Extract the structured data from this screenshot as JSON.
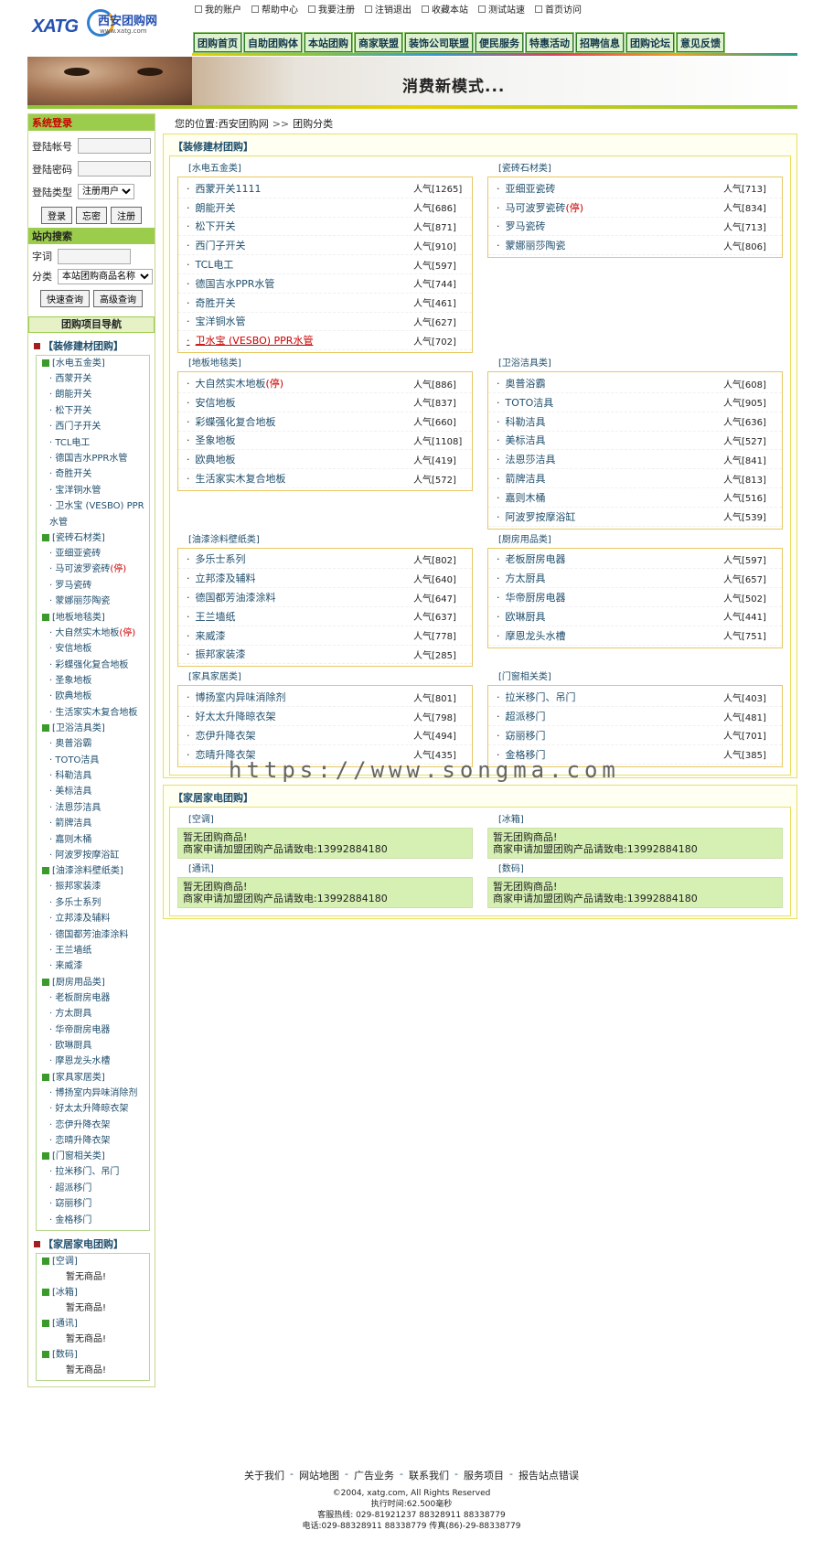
{
  "logo": {
    "brand": "XATG",
    "name": "西安团购网",
    "url": "www.xatg.com"
  },
  "toplinks": [
    "我的账户",
    "帮助中心",
    "我要注册",
    "注销退出",
    "收藏本站",
    "测试站速",
    "首页访问"
  ],
  "nav": [
    "团购首页",
    "自助团购体",
    "本站团购",
    "商家联盟",
    "装饰公司联盟",
    "便民服务",
    "特惠活动",
    "招聘信息",
    "团购论坛",
    "意见反馈"
  ],
  "banner": {
    "slogan": "消费新模式..."
  },
  "login": {
    "title": "系统登录",
    "account_label": "登陆帐号",
    "password_label": "登陆密码",
    "type_label": "登陆类型",
    "type_value": "注册用户",
    "btn_login": "登录",
    "btn_forgot": "忘密",
    "btn_register": "注册"
  },
  "search": {
    "title": "站内搜索",
    "keyword_label": "字词",
    "category_label": "分类",
    "category_value": "本站团购商品名称",
    "btn_quick": "快速查询",
    "btn_advanced": "高级查询"
  },
  "tree_nav": {
    "title": "团购项目导航",
    "cat1": {
      "label": "【装修建材团购】",
      "subs": [
        {
          "label": "[水电五金类]",
          "items": [
            "西蒙开关",
            "朗能开关",
            "松下开关",
            "西门子开关",
            "TCL电工",
            "德国吉水PPR水管",
            "奇胜开关",
            "宝洋铜水管",
            "卫水宝 (VESBO) PPR水管"
          ]
        },
        {
          "label": "[瓷砖石材类]",
          "items": [
            "亚细亚瓷砖",
            "马可波罗瓷砖",
            "罗马瓷砖",
            "蒙娜丽莎陶瓷"
          ]
        },
        {
          "label": "[地板地毯类]",
          "items": [
            "大自然实木地板",
            "安信地板",
            "彩蝶强化复合地板",
            "圣象地板",
            "欧典地板",
            "生活家实木复合地板"
          ]
        },
        {
          "label": "[卫浴洁具类]",
          "items": [
            "奥普浴霸",
            "TOTO洁具",
            "科勒洁具",
            "美标洁具",
            "法恩莎洁具",
            "箭牌洁具",
            "嘉则木桶",
            "阿波罗按摩浴缸"
          ]
        },
        {
          "label": "[油漆涂料壁纸类]",
          "items": [
            "振邦家装漆",
            "多乐士系列",
            "立邦漆及辅料",
            "德国都芳油漆涂料",
            "王兰墙纸",
            "来威漆"
          ]
        },
        {
          "label": "[厨房用品类]",
          "items": [
            "老板厨房电器",
            "方太厨具",
            "华帝厨房电器",
            "欧琳厨具",
            "摩恩龙头水槽"
          ]
        },
        {
          "label": "[家具家居类]",
          "items": [
            "博扬室内异味消除剂",
            "好太太升降晾衣架",
            "恋伊升降衣架",
            "恋晴升降衣架"
          ]
        },
        {
          "label": "[门窗相关类]",
          "items": [
            "拉米移门、吊门",
            "超派移门",
            "窈丽移门",
            "金格移门"
          ]
        }
      ],
      "hot_items": [
        "马可波罗瓷砖",
        "大自然实木地板"
      ],
      "hot_tag": "(停)"
    },
    "cat2": {
      "label": "【家居家电团购】",
      "subs": [
        "[空调]",
        "[冰箱]",
        "[通讯]",
        "[数码]"
      ],
      "none_text": "暂无商品!"
    }
  },
  "breadcrumb": {
    "label": "您的位置:",
    "site": "西安团购网",
    "sep": ">>",
    "page": "团购分类"
  },
  "main": {
    "pop_label": "人气",
    "group1_title": "【装修建材团购】",
    "group1": [
      {
        "title": "[水电五金类]",
        "items": [
          [
            "西蒙开关1111",
            "[1265]"
          ],
          [
            "朗能开关",
            "[686]"
          ],
          [
            "松下开关",
            "[871]"
          ],
          [
            "西门子开关",
            "[910]"
          ],
          [
            "TCL电工",
            "[597]"
          ],
          [
            "德国吉水PPR水管",
            "[744]"
          ],
          [
            "奇胜开关",
            "[461]"
          ],
          [
            "宝洋铜水管",
            "[627]"
          ],
          [
            "卫水宝 (VESBO) PPR水管",
            "[702]"
          ]
        ]
      },
      {
        "title": "[瓷砖石材类]",
        "items": [
          [
            "亚细亚瓷砖",
            "[713]"
          ],
          [
            "马可波罗瓷砖(停)",
            "[834]"
          ],
          [
            "罗马瓷砖",
            "[713]"
          ],
          [
            "蒙娜丽莎陶瓷",
            "[806]"
          ]
        ]
      },
      {
        "title": "[地板地毯类]",
        "items": [
          [
            "大自然实木地板(停)",
            "[886]"
          ],
          [
            "安信地板",
            "[837]"
          ],
          [
            "彩蝶强化复合地板",
            "[660]"
          ],
          [
            "圣象地板",
            "[1108]"
          ],
          [
            "欧典地板",
            "[419]"
          ],
          [
            "生活家实木复合地板",
            "[572]"
          ]
        ]
      },
      {
        "title": "[卫浴洁具类]",
        "items": [
          [
            "奥普浴霸",
            "[608]"
          ],
          [
            "TOTO洁具",
            "[905]"
          ],
          [
            "科勒洁具",
            "[636]"
          ],
          [
            "美标洁具",
            "[527]"
          ],
          [
            "法恩莎洁具",
            "[841]"
          ],
          [
            "箭牌洁具",
            "[813]"
          ],
          [
            "嘉则木桶",
            "[516]"
          ],
          [
            "阿波罗按摩浴缸",
            "[539]"
          ]
        ]
      },
      {
        "title": "[油漆涂料壁纸类]",
        "items": [
          [
            "多乐士系列",
            "[802]"
          ],
          [
            "立邦漆及辅料",
            "[640]"
          ],
          [
            "德国都芳油漆涂料",
            "[647]"
          ],
          [
            "王兰墙纸",
            "[637]"
          ],
          [
            "来威漆",
            "[778]"
          ],
          [
            "振邦家装漆",
            "[285]"
          ]
        ]
      },
      {
        "title": "[厨房用品类]",
        "items": [
          [
            "老板厨房电器",
            "[597]"
          ],
          [
            "方太厨具",
            "[657]"
          ],
          [
            "华帝厨房电器",
            "[502]"
          ],
          [
            "欧琳厨具",
            "[441]"
          ],
          [
            "摩恩龙头水槽",
            "[751]"
          ]
        ]
      },
      {
        "title": "[家具家居类]",
        "items": [
          [
            "博扬室内异味消除剂",
            "[801]"
          ],
          [
            "好太太升降晾衣架",
            "[798]"
          ],
          [
            "恋伊升降衣架",
            "[494]"
          ],
          [
            "恋晴升降衣架",
            "[435]"
          ]
        ]
      },
      {
        "title": "[门窗相关类]",
        "items": [
          [
            "拉米移门、吊门",
            "[403]"
          ],
          [
            "超派移门",
            "[481]"
          ],
          [
            "窈丽移门",
            "[701]"
          ],
          [
            "金格移门",
            "[385]"
          ]
        ]
      }
    ],
    "group2_title": "【家居家电团购】",
    "group2": [
      "[空调]",
      "[冰箱]",
      "[通讯]",
      "[数码]"
    ],
    "empty_line1": "暂无团购商品!",
    "empty_line2": "商家申请加盟团购产品请致电:13992884180"
  },
  "footer": {
    "links": [
      "关于我们",
      "网站地图",
      "广告业务",
      "联系我们",
      "服务项目",
      "报告站点错误"
    ],
    "link_sep": "-",
    "copyright": "©2004, xatg.com, All Rights Reserved",
    "exec_time": "执行时间:62.500毫秒",
    "hotline": "客服热线: 029-81921237 88328911 88338779",
    "phone": "电话:029-88328911 88338779 传真(86)-29-88338779"
  },
  "watermark": "https://www.songma.com",
  "colors": {
    "accent_green": "#9ccc4c",
    "link_blue": "#1f4e6c",
    "hot_red": "#cc0000",
    "border_yellow": "#e8e060"
  }
}
